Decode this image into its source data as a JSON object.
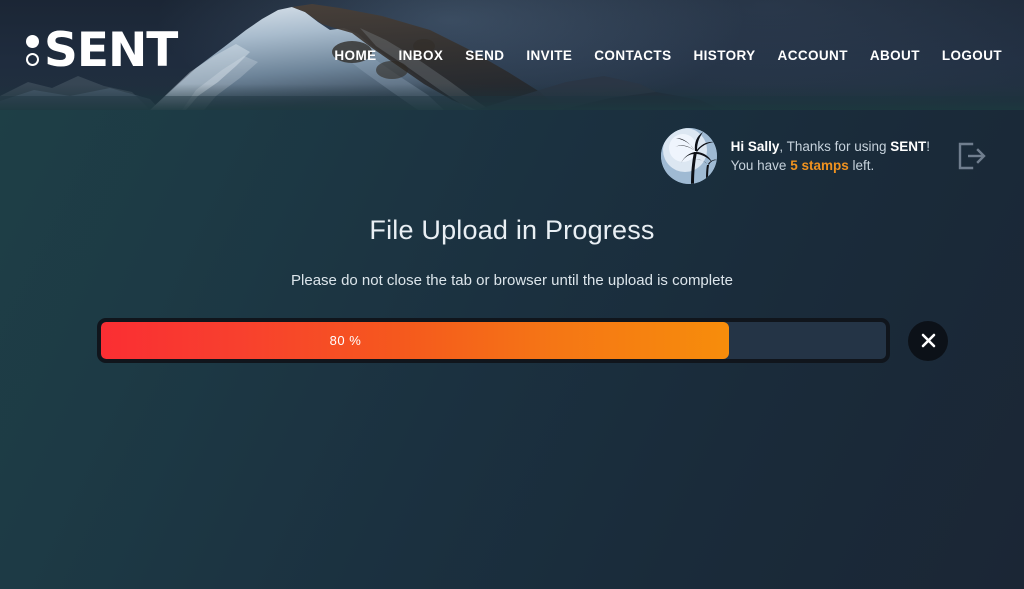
{
  "brand": {
    "name": "SENT",
    "logo_mark": "two-dots-mark"
  },
  "nav": {
    "items": [
      {
        "label": "HOME",
        "name": "nav-home"
      },
      {
        "label": "INBOX",
        "name": "nav-inbox"
      },
      {
        "label": "SEND",
        "name": "nav-send"
      },
      {
        "label": "INVITE",
        "name": "nav-invite"
      },
      {
        "label": "CONTACTS",
        "name": "nav-contacts"
      },
      {
        "label": "HISTORY",
        "name": "nav-history"
      },
      {
        "label": "ACCOUNT",
        "name": "nav-account"
      },
      {
        "label": "ABOUT",
        "name": "nav-about"
      },
      {
        "label": "LOGOUT",
        "name": "nav-logout"
      }
    ]
  },
  "greeting": {
    "hi": "Hi Sally",
    "thanks_text": ", Thanks for using ",
    "brand": "SENT",
    "bang": "!",
    "you_have": "You have ",
    "stamps": "5 stamps",
    "left": " left.",
    "avatar_alt": "palm-tree-avatar",
    "logout_icon": "sign-out-icon"
  },
  "main": {
    "title": "File Upload in Progress",
    "subtitle": "Please do not close the tab or browser until the upload is complete"
  },
  "progress": {
    "percent": 80,
    "label": "80 %",
    "fill_start_color": "#fa2e33",
    "fill_end_color": "#f78d0b",
    "cancel_icon": "close-x-icon",
    "cancel_label": "Cancel upload"
  }
}
